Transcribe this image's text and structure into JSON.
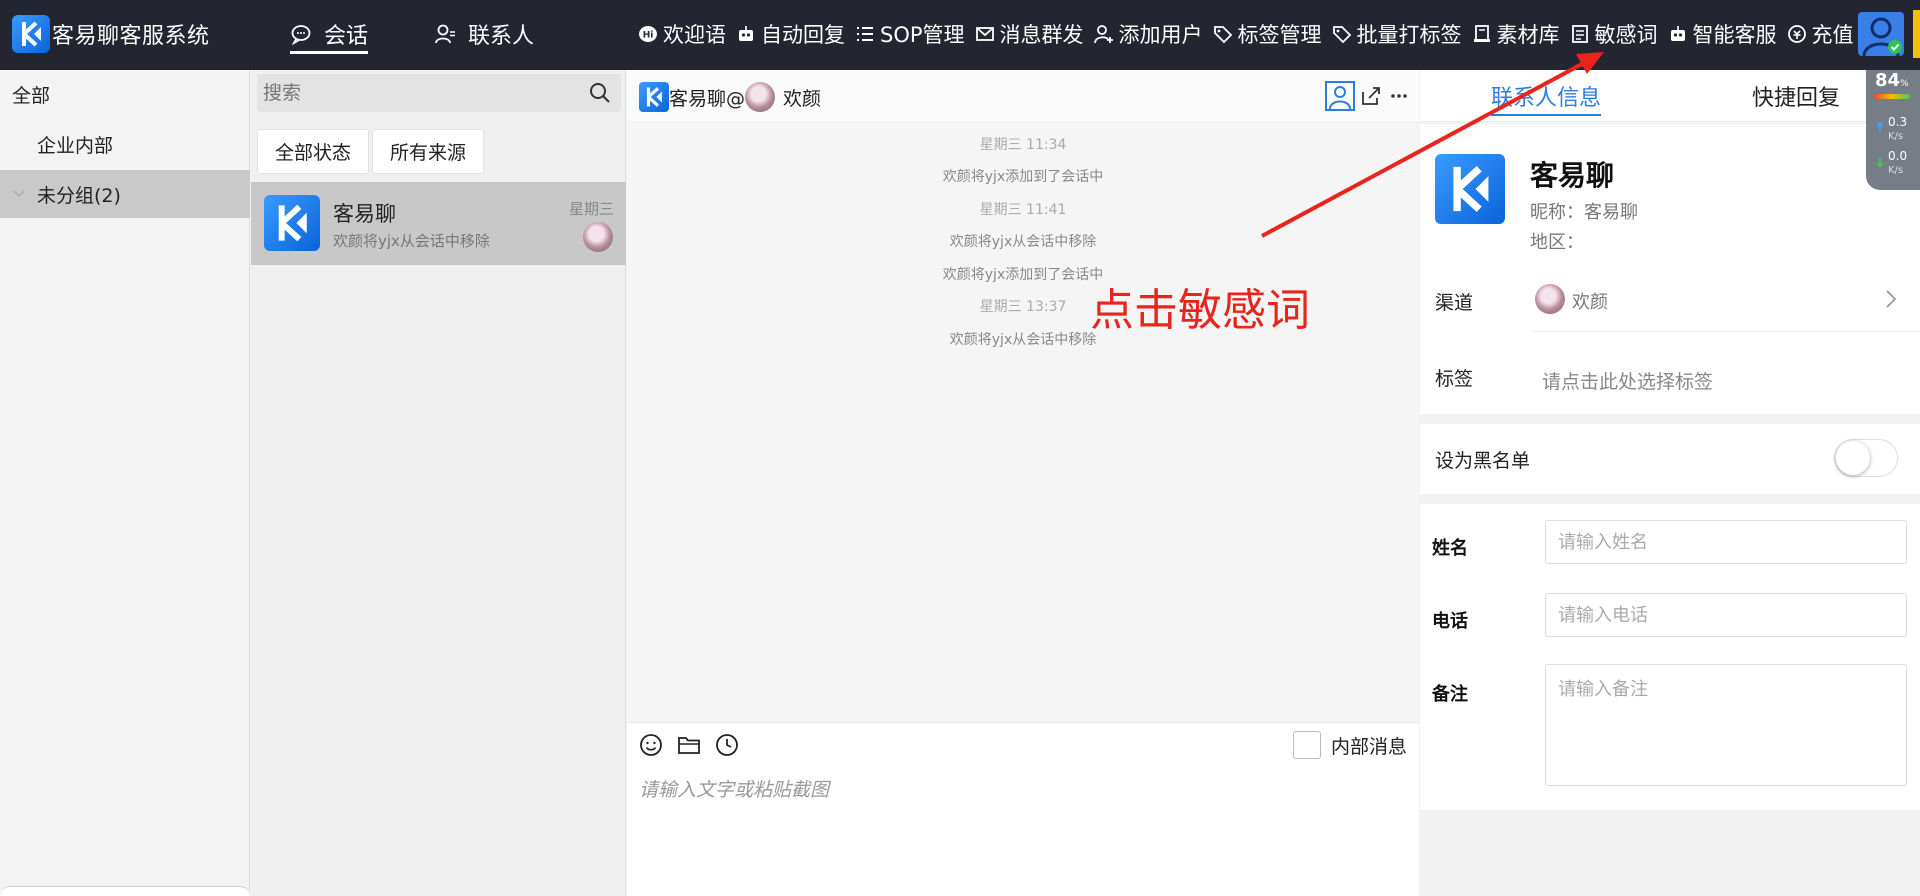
{
  "app": {
    "title": "客易聊客服系统"
  },
  "nav": {
    "tabs": [
      {
        "label": "会话",
        "icon": "chat-bubble-icon",
        "active": true
      },
      {
        "label": "联系人",
        "icon": "contact-icon",
        "active": false
      }
    ]
  },
  "menu": {
    "items": [
      {
        "label": "欢迎语",
        "icon": "hi-icon"
      },
      {
        "label": "自动回复",
        "icon": "robot-icon"
      },
      {
        "label": "SOP管理",
        "icon": "list-icon"
      },
      {
        "label": "消息群发",
        "icon": "mail-icon"
      },
      {
        "label": "添加用户",
        "icon": "add-user-icon"
      },
      {
        "label": "标签管理",
        "icon": "tag-icon"
      },
      {
        "label": "批量打标签",
        "icon": "tag-icon"
      },
      {
        "label": "素材库",
        "icon": "library-icon"
      },
      {
        "label": "敏感词",
        "icon": "word-icon"
      },
      {
        "label": "智能客服",
        "icon": "robot-icon"
      },
      {
        "label": "充值",
        "icon": "recharge-icon"
      }
    ]
  },
  "groups": {
    "items": [
      {
        "label": "全部"
      },
      {
        "label": "企业内部"
      },
      {
        "label": "未分组(2)"
      }
    ]
  },
  "conversations": {
    "search_placeholder": "搜索",
    "filters": [
      {
        "label": "全部状态"
      },
      {
        "label": "所有来源"
      }
    ],
    "items": [
      {
        "name": "客易聊",
        "preview": "欢颜将yjx从会话中移除",
        "time": "星期三"
      }
    ]
  },
  "chat": {
    "title_prefix": "客易聊@",
    "title_contact": "欢颜",
    "messages": [
      {
        "type": "time",
        "text": "星期三 11:34"
      },
      {
        "type": "note",
        "text": "欢颜将yjx添加到了会话中"
      },
      {
        "type": "time",
        "text": "星期三 11:41"
      },
      {
        "type": "note",
        "text": "欢颜将yjx从会话中移除"
      },
      {
        "type": "note",
        "text": "欢颜将yjx添加到了会话中"
      },
      {
        "type": "time",
        "text": "星期三 13:37"
      },
      {
        "type": "note",
        "text": "欢颜将yjx从会话中移除"
      }
    ],
    "internal_label": "内部消息",
    "input_placeholder": "请输入文字或粘贴截图"
  },
  "right_panel": {
    "tabs": [
      {
        "label": "联系人信息",
        "active": true
      },
      {
        "label": "快捷回复",
        "active": false
      }
    ],
    "profile": {
      "name": "客易聊",
      "nickname": "昵称：客易聊",
      "region": "地区："
    },
    "channel": {
      "label": "渠道",
      "value": "欢颜"
    },
    "tags": {
      "label": "标签",
      "placeholder": "请点击此处选择标签"
    },
    "blacklist": {
      "label": "设为黑名单",
      "on": false
    },
    "fields": {
      "name": {
        "label": "姓名",
        "placeholder": "请输入姓名"
      },
      "phone": {
        "label": "电话",
        "placeholder": "请输入电话"
      },
      "note": {
        "label": "备注",
        "placeholder": "请输入备注"
      }
    }
  },
  "network": {
    "battery": "84",
    "unit": "%",
    "up": "0.3",
    "down": "0.0",
    "rate_unit": "K/s"
  },
  "annotation": {
    "text": "点击敏感词",
    "color": "#e8241c"
  },
  "colors": {
    "topbar": "#232631",
    "accent": "#2a7de1",
    "selected": "#c8c8c8"
  }
}
